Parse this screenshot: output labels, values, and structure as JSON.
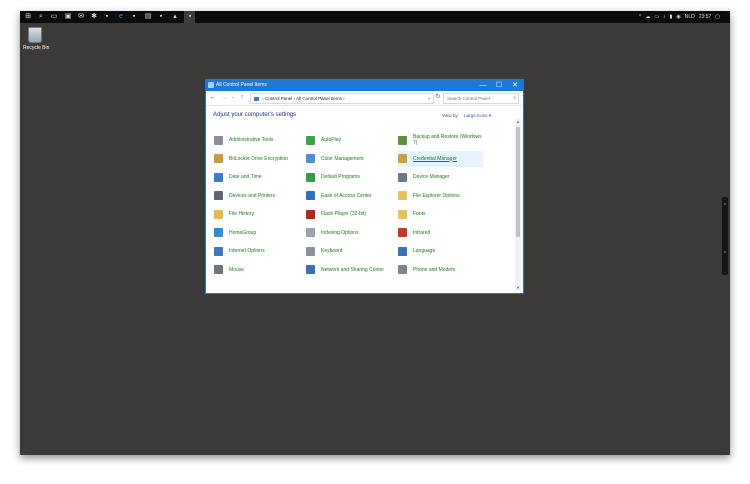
{
  "desktop": {
    "recycle_bin_label": "Recycle Bin"
  },
  "taskbar": {
    "clock": "23:57",
    "lang": "NLD"
  },
  "window": {
    "title": "All Control Panel Items",
    "minimize": "—",
    "maximize": "☐",
    "close": "✕",
    "breadcrumb": [
      "Control Panel",
      "All Control Panel Items"
    ],
    "search_placeholder": "Search Control Panel",
    "heading": "Adjust your computer's settings",
    "view_by_label": "View by:",
    "view_by_value": "Large icons ▾",
    "accent": "#1e78d6"
  },
  "items": [
    {
      "label": "Administrative Tools",
      "icon": "admin-tools-icon",
      "color": "#8a8f95"
    },
    {
      "label": "AutoPlay",
      "icon": "autoplay-icon",
      "color": "#3aa54a"
    },
    {
      "label": "Backup and Restore (Windows 7)",
      "icon": "backup-icon",
      "color": "#5f8f3e"
    },
    {
      "label": "BitLocker Drive Encryption",
      "icon": "bitlocker-icon",
      "color": "#c89b3c"
    },
    {
      "label": "Color Management",
      "icon": "color-management-icon",
      "color": "#4c8fd6"
    },
    {
      "label": "Credential Manager",
      "icon": "credential-manager-icon",
      "color": "#c8a040"
    },
    {
      "label": "Date and Time",
      "icon": "date-time-icon",
      "color": "#3b7cc9"
    },
    {
      "label": "Default Programs",
      "icon": "default-programs-icon",
      "color": "#2f9e44"
    },
    {
      "label": "Device Manager",
      "icon": "device-manager-icon",
      "color": "#6c7a88"
    },
    {
      "label": "Devices and Printers",
      "icon": "devices-printers-icon",
      "color": "#5c6670"
    },
    {
      "label": "Ease of Access Center",
      "icon": "ease-of-access-icon",
      "color": "#2a6fc9"
    },
    {
      "label": "File Explorer Options",
      "icon": "file-explorer-options-icon",
      "color": "#e8c25a"
    },
    {
      "label": "File History",
      "icon": "file-history-icon",
      "color": "#e6b94a"
    },
    {
      "label": "Flash Player (32-bit)",
      "icon": "flash-player-icon",
      "color": "#b3261e"
    },
    {
      "label": "Fonts",
      "icon": "fonts-icon",
      "color": "#e8c25a"
    },
    {
      "label": "HomeGroup",
      "icon": "homegroup-icon",
      "color": "#2a8fd6"
    },
    {
      "label": "Indexing Options",
      "icon": "indexing-options-icon",
      "color": "#9aa3ab"
    },
    {
      "label": "Infrared",
      "icon": "infrared-icon",
      "color": "#c0392b"
    },
    {
      "label": "Internet Options",
      "icon": "internet-options-icon",
      "color": "#3a78c2"
    },
    {
      "label": "Keyboard",
      "icon": "keyboard-icon",
      "color": "#8b9299"
    },
    {
      "label": "Language",
      "icon": "language-icon",
      "color": "#3b6fc0"
    },
    {
      "label": "Mouse",
      "icon": "mouse-icon",
      "color": "#6d747b"
    },
    {
      "label": "Network and Sharing Center",
      "icon": "network-sharing-icon",
      "color": "#3a6fb8"
    },
    {
      "label": "Phone and Modem",
      "icon": "phone-modem-icon",
      "color": "#7d8790"
    }
  ]
}
